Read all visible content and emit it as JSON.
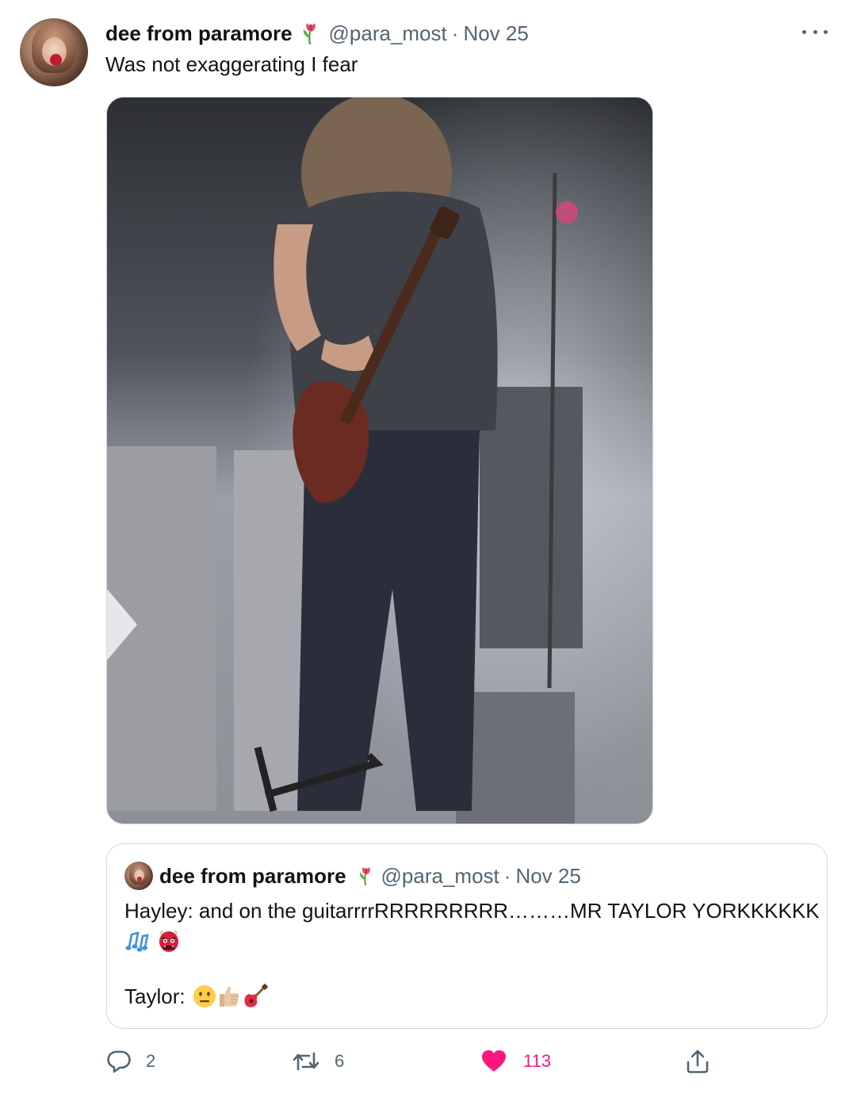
{
  "tweet": {
    "author_name": "dee from paramore",
    "handle": "@para_most",
    "separator": "·",
    "date": "Nov 25",
    "text": "Was not exaggerating I fear"
  },
  "quoted_tweet": {
    "author_name": "dee from paramore",
    "handle": "@para_most",
    "separator": "·",
    "date": "Nov 25",
    "text_line1": "Hayley: and on the guitarrrrRRRRRRRRR………MR TAYLOR YORKKKKKK",
    "text_line2_emojis": [
      "musical-notes-icon",
      "ogre-icon"
    ],
    "text_line3": "Taylor:",
    "text_line3_emojis": [
      "neutral-face-icon",
      "thumbs-up-icon",
      "guitar-icon"
    ]
  },
  "actions": {
    "reply_count": "2",
    "retweet_count": "6",
    "like_count": "113"
  },
  "colors": {
    "text_primary": "#0f1419",
    "text_secondary": "#536471",
    "like_active": "#f91880",
    "border": "#cfd9de"
  },
  "icons": [
    "tulip-icon",
    "more-icon",
    "reply-icon",
    "retweet-icon",
    "heart-icon",
    "share-icon"
  ]
}
